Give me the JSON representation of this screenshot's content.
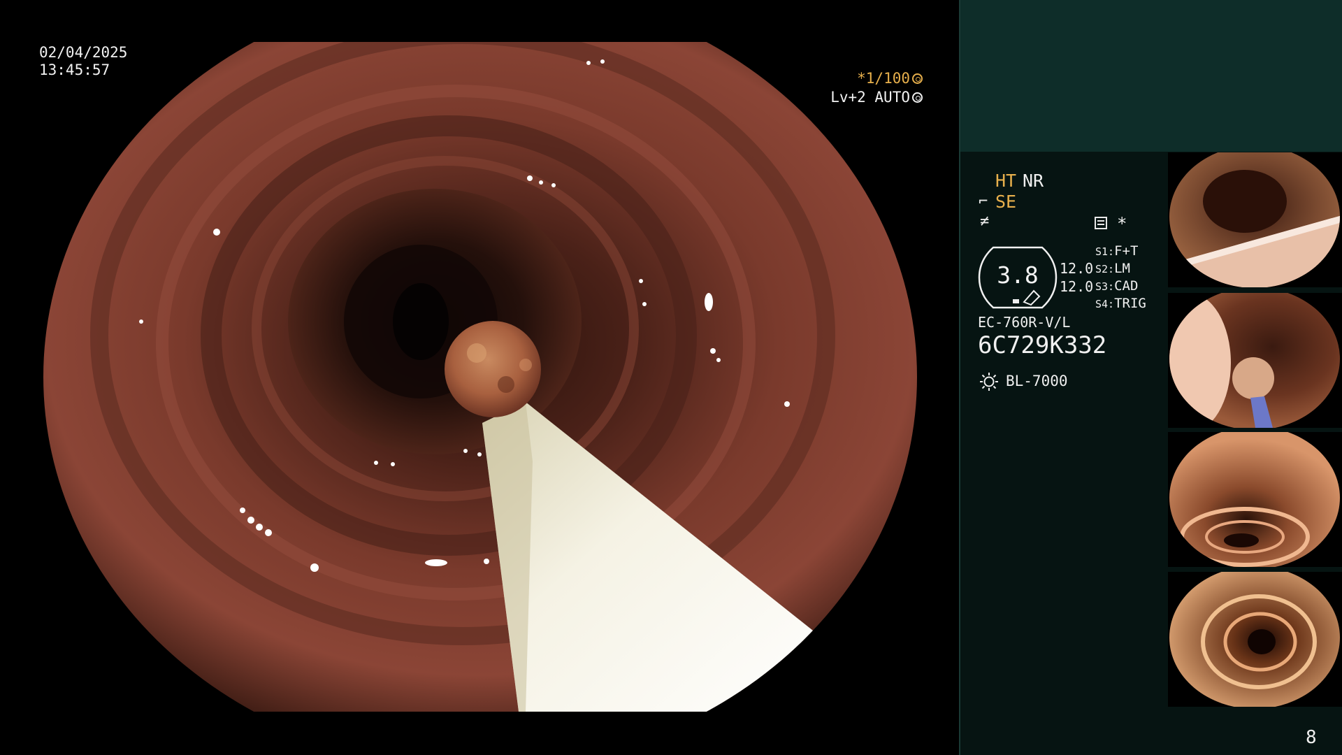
{
  "osd": {
    "date": "02/04/2025",
    "time": "13:45:57",
    "shutter": "*1/100",
    "level": "Lv+2 AUTO"
  },
  "panel": {
    "ht": "HT",
    "nr": "NR",
    "se": "SE",
    "gauge_value": "3.8",
    "value_a": "12.0",
    "value_b": "12.0",
    "switches": [
      {
        "key": "S1:",
        "value": "F+T"
      },
      {
        "key": "S2:",
        "value": "LM"
      },
      {
        "key": "S3:",
        "value": "CAD"
      },
      {
        "key": "S4:",
        "value": "TRIG"
      }
    ],
    "scope_model": "EC-760R-V/L",
    "scope_serial": "6C729K332",
    "light_source": "BL-7000",
    "page_number": "8"
  },
  "colors": {
    "panel_top": "#0e2d29",
    "panel_bottom": "#061412",
    "accent_orange": "#e8b04c",
    "text": "#f0f0f0"
  },
  "icons": {
    "shutter": "aperture-icon",
    "level": "iris-icon",
    "structure_enhance": "se-icon",
    "freeze": "freeze-icon",
    "menu": "menu-icon",
    "star": "star-icon",
    "light": "sun-icon"
  }
}
